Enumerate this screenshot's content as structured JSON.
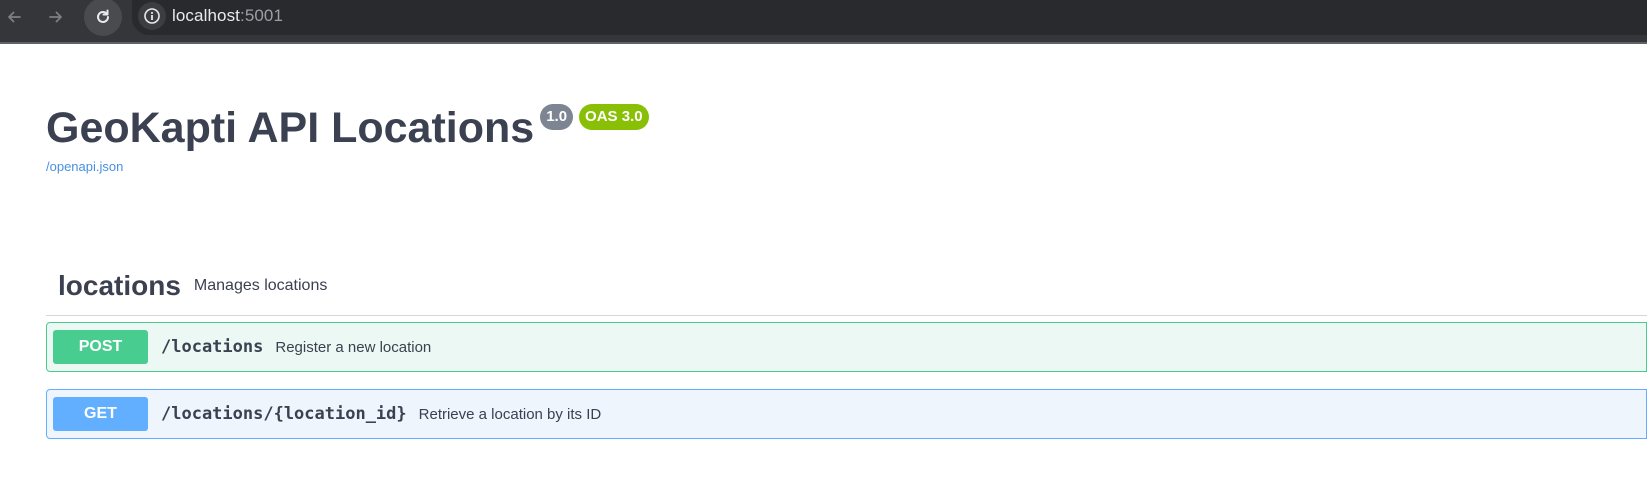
{
  "browser": {
    "url_host": "localhost",
    "url_port": ":5001"
  },
  "info": {
    "title": "GeoKapti API Locations",
    "version": "1.0",
    "oas_version": "OAS 3.0",
    "spec_link": "/openapi.json"
  },
  "tag": {
    "name": "locations",
    "description": "Manages locations"
  },
  "operations": [
    {
      "method": "POST",
      "path": "/locations",
      "summary": "Register a new location"
    },
    {
      "method": "GET",
      "path": "/locations/{location_id}",
      "summary": "Retrieve a location by its ID"
    }
  ],
  "colors": {
    "post": "#49cc90",
    "get": "#61affe",
    "oas_badge": "#89bf04",
    "version_badge": "#7d8492",
    "text": "#3b4151"
  },
  "icons": {
    "back": "arrow-left-icon",
    "forward": "arrow-right-icon",
    "reload": "reload-icon",
    "site_info": "info-icon"
  }
}
